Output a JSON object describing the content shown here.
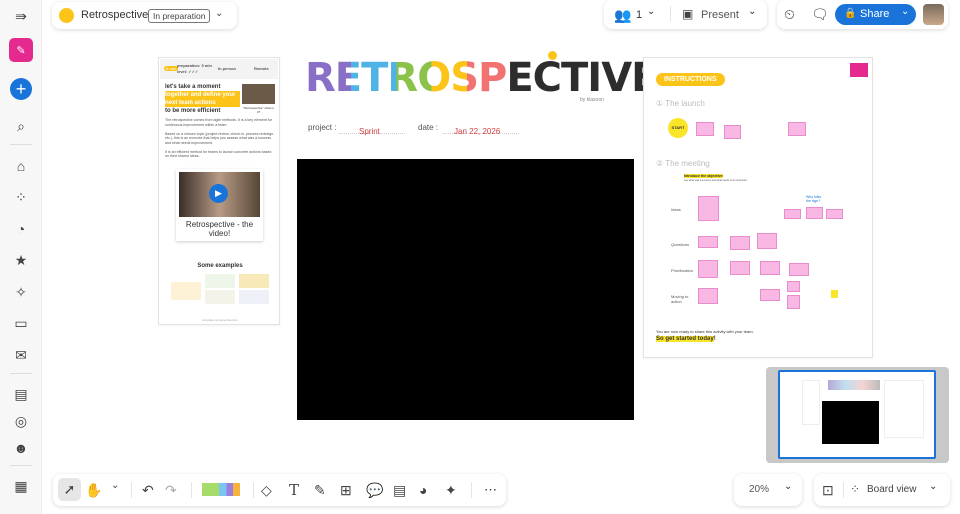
{
  "header": {
    "board_title": "Retrospective",
    "status_badge": "In preparation",
    "participants_count": "1",
    "present_label": "Present",
    "share_label": "Share"
  },
  "board": {
    "logo_text": "RETROSPECTIVE",
    "logo_byline": "by klaxoon",
    "project_label": "project :",
    "project_value": "Sprint",
    "date_label": "date :",
    "date_value": "Jan 22, 2026",
    "left_panel": {
      "duration_badge": "5 min",
      "preparation": "preparation: 5 min",
      "level": "level: ✓✓✓",
      "in_person": "In person",
      "remote": "Remote",
      "headline_1": "let's take a moment",
      "headline_2": "together and define your next team actions",
      "headline_3": "to be more efficient",
      "video_thumb_caption": "\"Retrospective\" what is it?",
      "para_1": "The retrospective comes from agile methods. It is a key element for continuous improvement within a team.",
      "para_2": "Based on a chosen topic (project review, check-in, process redesign, etc.), this is an exercise that helps you assess what was a success and what needs improvement.",
      "para_3": "It is an efficient method for teams to launch concrete actions based on their shared ideas.",
      "video_title": "Retrospective - the video!",
      "examples_title": "Some examples",
      "footer": "template retrospective.klxn"
    },
    "instructions": {
      "badge": "INSTRUCTIONS",
      "step1": "The launch",
      "step2": "The meeting",
      "start": "START",
      "objective": "Introduce the objective:",
      "objective_sub": "see what was a success and what needs to be improved",
      "rows": [
        "Ideas",
        "Questions",
        "Prioritization",
        "Moving to action"
      ],
      "why": "Why folks the sign?",
      "ready": "You are now ready to share this activity with your team.",
      "cta": "So get started today",
      "cta_end": "!"
    }
  },
  "toolbar": {
    "zoom_level": "20%",
    "board_view_label": "Board view",
    "more": "⋯"
  },
  "colors": {
    "accent": "#1a73d9",
    "brand": "#e52a8f",
    "yellow": "#fcc419"
  }
}
